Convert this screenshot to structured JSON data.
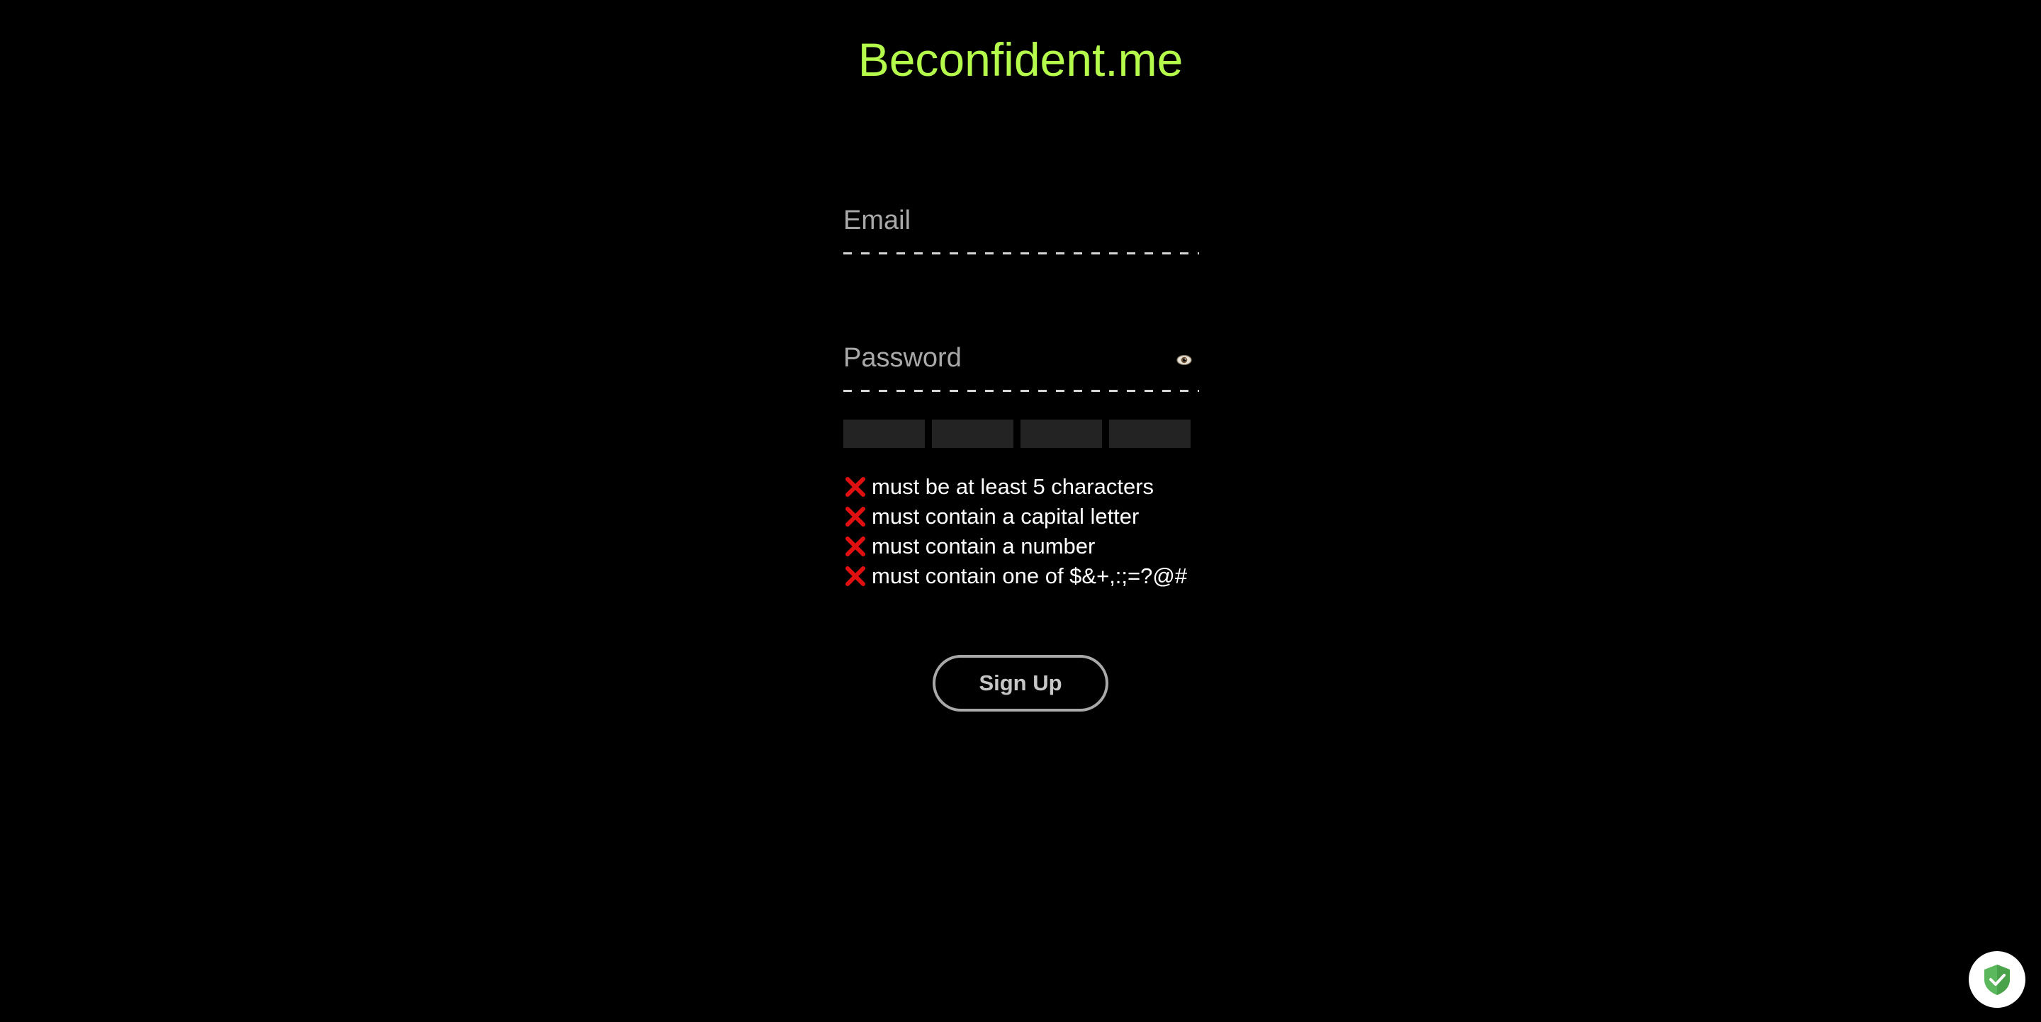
{
  "brand": {
    "title": "Beconfident.me",
    "color": "#b4fb4c"
  },
  "form": {
    "email": {
      "placeholder": "Email",
      "value": ""
    },
    "password": {
      "placeholder": "Password",
      "value": "",
      "toggle_icon": "eye-icon"
    },
    "strength_meter": {
      "segments": 4,
      "filled": 0
    },
    "rules": [
      {
        "icon": "cross-icon",
        "text": "must be at least 5 characters",
        "met": false
      },
      {
        "icon": "cross-icon",
        "text": "must contain a capital letter",
        "met": false
      },
      {
        "icon": "cross-icon",
        "text": "must contain a number",
        "met": false
      },
      {
        "icon": "cross-icon",
        "text": "must contain one of $&+,:;=?@#",
        "met": false
      }
    ],
    "submit_label": "Sign Up"
  },
  "security_badge": {
    "icon": "shield-check-icon",
    "color": "#5cb85c"
  }
}
